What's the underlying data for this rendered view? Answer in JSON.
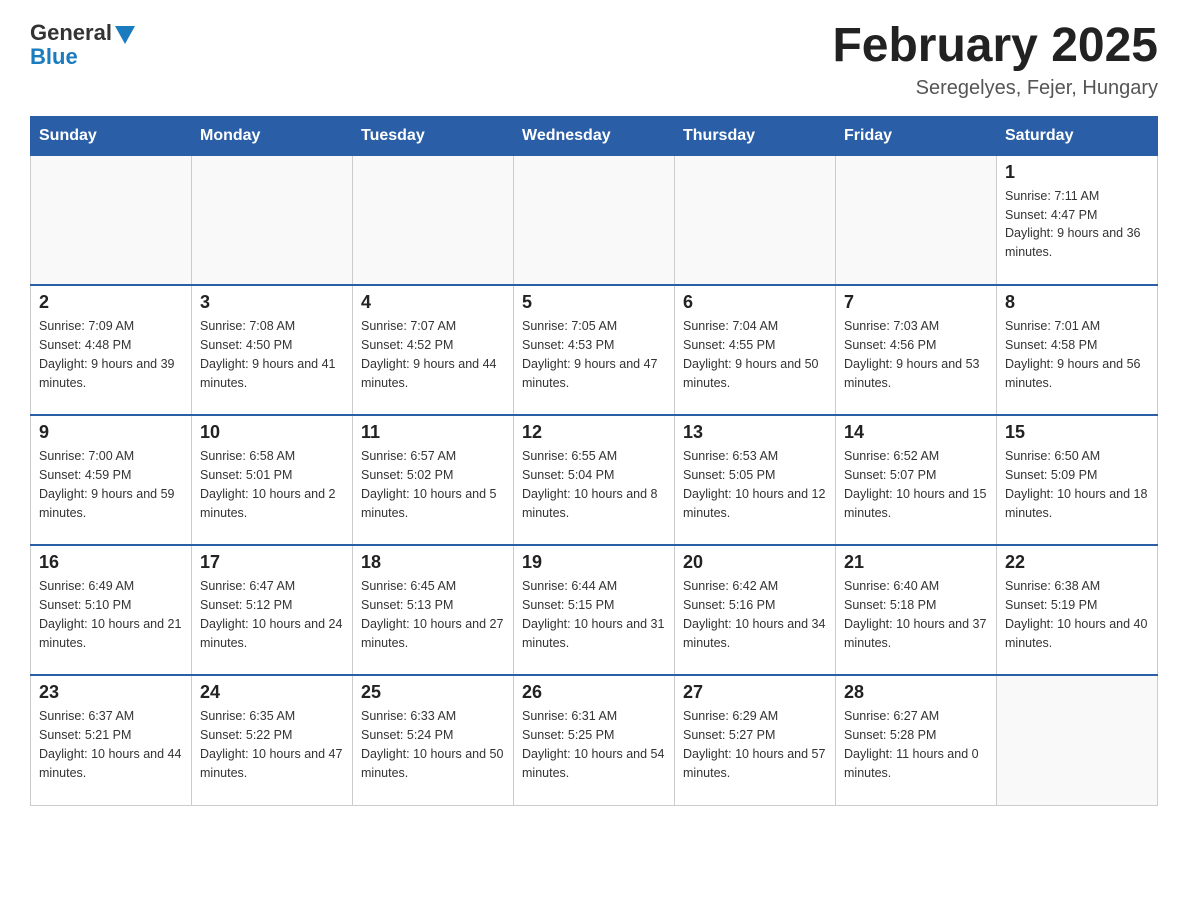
{
  "logo": {
    "general": "General",
    "blue": "Blue"
  },
  "title": "February 2025",
  "subtitle": "Seregelyes, Fejer, Hungary",
  "days_of_week": [
    "Sunday",
    "Monday",
    "Tuesday",
    "Wednesday",
    "Thursday",
    "Friday",
    "Saturday"
  ],
  "weeks": [
    [
      {
        "day": "",
        "info": ""
      },
      {
        "day": "",
        "info": ""
      },
      {
        "day": "",
        "info": ""
      },
      {
        "day": "",
        "info": ""
      },
      {
        "day": "",
        "info": ""
      },
      {
        "day": "",
        "info": ""
      },
      {
        "day": "1",
        "info": "Sunrise: 7:11 AM\nSunset: 4:47 PM\nDaylight: 9 hours and 36 minutes."
      }
    ],
    [
      {
        "day": "2",
        "info": "Sunrise: 7:09 AM\nSunset: 4:48 PM\nDaylight: 9 hours and 39 minutes."
      },
      {
        "day": "3",
        "info": "Sunrise: 7:08 AM\nSunset: 4:50 PM\nDaylight: 9 hours and 41 minutes."
      },
      {
        "day": "4",
        "info": "Sunrise: 7:07 AM\nSunset: 4:52 PM\nDaylight: 9 hours and 44 minutes."
      },
      {
        "day": "5",
        "info": "Sunrise: 7:05 AM\nSunset: 4:53 PM\nDaylight: 9 hours and 47 minutes."
      },
      {
        "day": "6",
        "info": "Sunrise: 7:04 AM\nSunset: 4:55 PM\nDaylight: 9 hours and 50 minutes."
      },
      {
        "day": "7",
        "info": "Sunrise: 7:03 AM\nSunset: 4:56 PM\nDaylight: 9 hours and 53 minutes."
      },
      {
        "day": "8",
        "info": "Sunrise: 7:01 AM\nSunset: 4:58 PM\nDaylight: 9 hours and 56 minutes."
      }
    ],
    [
      {
        "day": "9",
        "info": "Sunrise: 7:00 AM\nSunset: 4:59 PM\nDaylight: 9 hours and 59 minutes."
      },
      {
        "day": "10",
        "info": "Sunrise: 6:58 AM\nSunset: 5:01 PM\nDaylight: 10 hours and 2 minutes."
      },
      {
        "day": "11",
        "info": "Sunrise: 6:57 AM\nSunset: 5:02 PM\nDaylight: 10 hours and 5 minutes."
      },
      {
        "day": "12",
        "info": "Sunrise: 6:55 AM\nSunset: 5:04 PM\nDaylight: 10 hours and 8 minutes."
      },
      {
        "day": "13",
        "info": "Sunrise: 6:53 AM\nSunset: 5:05 PM\nDaylight: 10 hours and 12 minutes."
      },
      {
        "day": "14",
        "info": "Sunrise: 6:52 AM\nSunset: 5:07 PM\nDaylight: 10 hours and 15 minutes."
      },
      {
        "day": "15",
        "info": "Sunrise: 6:50 AM\nSunset: 5:09 PM\nDaylight: 10 hours and 18 minutes."
      }
    ],
    [
      {
        "day": "16",
        "info": "Sunrise: 6:49 AM\nSunset: 5:10 PM\nDaylight: 10 hours and 21 minutes."
      },
      {
        "day": "17",
        "info": "Sunrise: 6:47 AM\nSunset: 5:12 PM\nDaylight: 10 hours and 24 minutes."
      },
      {
        "day": "18",
        "info": "Sunrise: 6:45 AM\nSunset: 5:13 PM\nDaylight: 10 hours and 27 minutes."
      },
      {
        "day": "19",
        "info": "Sunrise: 6:44 AM\nSunset: 5:15 PM\nDaylight: 10 hours and 31 minutes."
      },
      {
        "day": "20",
        "info": "Sunrise: 6:42 AM\nSunset: 5:16 PM\nDaylight: 10 hours and 34 minutes."
      },
      {
        "day": "21",
        "info": "Sunrise: 6:40 AM\nSunset: 5:18 PM\nDaylight: 10 hours and 37 minutes."
      },
      {
        "day": "22",
        "info": "Sunrise: 6:38 AM\nSunset: 5:19 PM\nDaylight: 10 hours and 40 minutes."
      }
    ],
    [
      {
        "day": "23",
        "info": "Sunrise: 6:37 AM\nSunset: 5:21 PM\nDaylight: 10 hours and 44 minutes."
      },
      {
        "day": "24",
        "info": "Sunrise: 6:35 AM\nSunset: 5:22 PM\nDaylight: 10 hours and 47 minutes."
      },
      {
        "day": "25",
        "info": "Sunrise: 6:33 AM\nSunset: 5:24 PM\nDaylight: 10 hours and 50 minutes."
      },
      {
        "day": "26",
        "info": "Sunrise: 6:31 AM\nSunset: 5:25 PM\nDaylight: 10 hours and 54 minutes."
      },
      {
        "day": "27",
        "info": "Sunrise: 6:29 AM\nSunset: 5:27 PM\nDaylight: 10 hours and 57 minutes."
      },
      {
        "day": "28",
        "info": "Sunrise: 6:27 AM\nSunset: 5:28 PM\nDaylight: 11 hours and 0 minutes."
      },
      {
        "day": "",
        "info": ""
      }
    ]
  ]
}
